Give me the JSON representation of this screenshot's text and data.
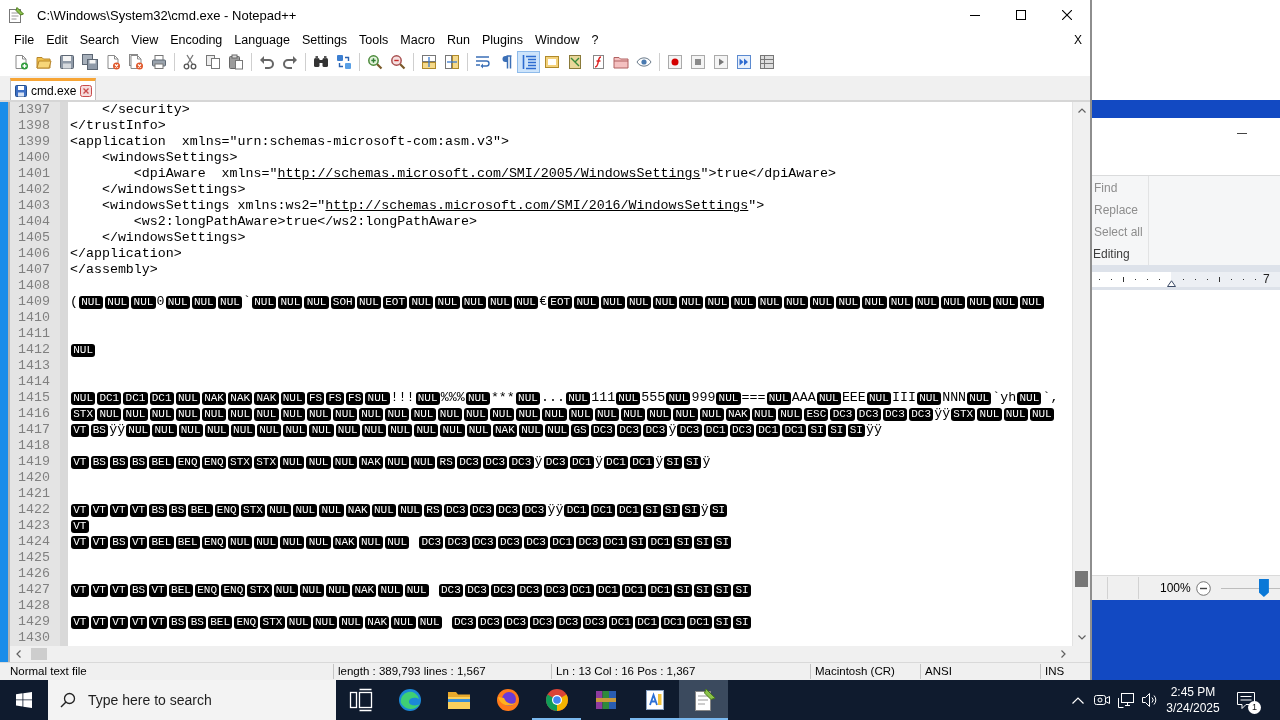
{
  "window": {
    "title": "C:\\Windows\\System32\\cmd.exe - Notepad++"
  },
  "menu": {
    "items": [
      "File",
      "Edit",
      "Search",
      "View",
      "Encoding",
      "Language",
      "Settings",
      "Tools",
      "Macro",
      "Run",
      "Plugins",
      "Window",
      "?"
    ],
    "close": "X"
  },
  "toolbar": [
    {
      "kind": "new",
      "on": false
    },
    {
      "kind": "open",
      "on": false
    },
    {
      "kind": "save",
      "on": false
    },
    {
      "kind": "save-all",
      "on": false
    },
    {
      "kind": "close",
      "on": false
    },
    {
      "kind": "close-all",
      "on": false
    },
    {
      "kind": "print",
      "on": false
    },
    {
      "kind": "separator"
    },
    {
      "kind": "cut",
      "on": false
    },
    {
      "kind": "copy",
      "on": false
    },
    {
      "kind": "paste",
      "on": false
    },
    {
      "kind": "separator"
    },
    {
      "kind": "undo",
      "on": false
    },
    {
      "kind": "redo",
      "on": false
    },
    {
      "kind": "separator"
    },
    {
      "kind": "find",
      "on": false
    },
    {
      "kind": "replace",
      "on": false
    },
    {
      "kind": "separator"
    },
    {
      "kind": "zoom-in",
      "on": false
    },
    {
      "kind": "zoom-out",
      "on": false
    },
    {
      "kind": "separator"
    },
    {
      "kind": "sync-vertical",
      "on": false
    },
    {
      "kind": "sync-horizontal",
      "on": false
    },
    {
      "kind": "separator"
    },
    {
      "kind": "word-wrap",
      "on": false
    },
    {
      "kind": "all-chars",
      "on": false
    },
    {
      "kind": "indent-guide",
      "on": true
    },
    {
      "kind": "user-language",
      "on": false
    },
    {
      "kind": "document-map",
      "on": false
    },
    {
      "kind": "function-list",
      "on": false
    },
    {
      "kind": "folder-workspace",
      "on": false
    },
    {
      "kind": "monitoring",
      "on": false
    },
    {
      "kind": "separator"
    },
    {
      "kind": "record",
      "on": false
    },
    {
      "kind": "stop",
      "on": false
    },
    {
      "kind": "play",
      "on": false
    },
    {
      "kind": "play-multiple",
      "on": false
    },
    {
      "kind": "save-macro",
      "on": false
    }
  ],
  "tabs": [
    {
      "label": "cmd.exe",
      "selected": true
    }
  ],
  "editor": {
    "lines": [
      {
        "number": "1397",
        "tokens": [
          {
            "kind": "text",
            "text": "    </security>"
          }
        ]
      },
      {
        "number": "1398",
        "tokens": [
          {
            "kind": "text",
            "text": "</trustInfo>"
          }
        ]
      },
      {
        "number": "1399",
        "tokens": [
          {
            "kind": "text",
            "text": "<application  xmlns=\"urn:schemas-microsoft-com:asm.v3\">"
          }
        ]
      },
      {
        "number": "1400",
        "tokens": [
          {
            "kind": "text",
            "text": "    <windowsSettings>"
          }
        ]
      },
      {
        "number": "1401",
        "tokens": [
          {
            "kind": "text",
            "text": "        <dpiAware  xmlns=\""
          },
          {
            "kind": "link",
            "text": "http://schemas.microsoft.com/SMI/2005/WindowsSettings"
          },
          {
            "kind": "text",
            "text": "\">true</dpiAware>"
          }
        ]
      },
      {
        "number": "1402",
        "tokens": [
          {
            "kind": "text",
            "text": "    </windowsSettings>"
          }
        ]
      },
      {
        "number": "1403",
        "tokens": [
          {
            "kind": "text",
            "text": "    <windowsSettings xmlns:ws2=\""
          },
          {
            "kind": "link",
            "text": "http://schemas.microsoft.com/SMI/2016/WindowsSettings"
          },
          {
            "kind": "text",
            "text": "\">"
          }
        ]
      },
      {
        "number": "1404",
        "tokens": [
          {
            "kind": "text",
            "text": "        <ws2:longPathAware>true</ws2:longPathAware>"
          }
        ]
      },
      {
        "number": "1405",
        "tokens": [
          {
            "kind": "text",
            "text": "    </windowsSettings>"
          }
        ]
      },
      {
        "number": "1406",
        "tokens": [
          {
            "kind": "text",
            "text": "</application>"
          }
        ]
      },
      {
        "number": "1407",
        "tokens": [
          {
            "kind": "text",
            "text": "</assembly>"
          }
        ]
      },
      {
        "number": "1408"
      },
      {
        "number": "1409",
        "tokens": [
          {
            "kind": "text",
            "text": "("
          },
          {
            "kind": "ctrl",
            "text": "NUL"
          },
          {
            "kind": "ctrl",
            "text": "NUL"
          },
          {
            "kind": "ctrl",
            "text": "NUL"
          },
          {
            "kind": "text",
            "text": "0"
          },
          {
            "kind": "ctrl",
            "text": "NUL"
          },
          {
            "kind": "ctrl",
            "text": "NUL"
          },
          {
            "kind": "ctrl",
            "text": "NUL"
          },
          {
            "kind": "text",
            "text": "`"
          },
          {
            "kind": "ctrl",
            "text": "NUL"
          },
          {
            "kind": "ctrl",
            "text": "NUL"
          },
          {
            "kind": "ctrl",
            "text": "NUL"
          },
          {
            "kind": "ctrl",
            "text": "SOH"
          },
          {
            "kind": "ctrl",
            "text": "NUL"
          },
          {
            "kind": "ctrl",
            "text": "EOT"
          },
          {
            "kind": "ctrl",
            "text": "NUL"
          },
          {
            "kind": "ctrl",
            "text": "NUL"
          },
          {
            "kind": "ctrl",
            "text": "NUL"
          },
          {
            "kind": "ctrl",
            "text": "NUL"
          },
          {
            "kind": "ctrl",
            "text": "NUL"
          },
          {
            "kind": "text",
            "text": "€"
          },
          {
            "kind": "ctrl",
            "text": "EOT"
          },
          {
            "kind": "ctrl",
            "text": "NUL"
          },
          {
            "kind": "ctrl",
            "text": "NUL"
          },
          {
            "kind": "ctrl",
            "text": "NUL"
          },
          {
            "kind": "ctrl",
            "text": "NUL"
          },
          {
            "kind": "ctrl",
            "text": "NUL"
          },
          {
            "kind": "ctrl",
            "text": "NUL"
          },
          {
            "kind": "ctrl",
            "text": "NUL"
          },
          {
            "kind": "ctrl",
            "text": "NUL"
          },
          {
            "kind": "ctrl",
            "text": "NUL"
          },
          {
            "kind": "ctrl",
            "text": "NUL"
          },
          {
            "kind": "ctrl",
            "text": "NUL"
          },
          {
            "kind": "ctrl",
            "text": "NUL"
          },
          {
            "kind": "ctrl",
            "text": "NUL"
          },
          {
            "kind": "ctrl",
            "text": "NUL"
          },
          {
            "kind": "ctrl",
            "text": "NUL"
          },
          {
            "kind": "ctrl",
            "text": "NUL"
          },
          {
            "kind": "ctrl",
            "text": "NUL"
          },
          {
            "kind": "ctrl",
            "text": "NUL"
          }
        ]
      },
      {
        "number": "1410"
      },
      {
        "number": "1411"
      },
      {
        "number": "1412",
        "tokens": [
          {
            "kind": "ctrl",
            "text": "NUL"
          }
        ]
      },
      {
        "number": "1413"
      },
      {
        "number": "1414"
      },
      {
        "number": "1415",
        "tokens": [
          {
            "kind": "ctrl",
            "text": "NUL"
          },
          {
            "kind": "ctrl",
            "text": "DC1"
          },
          {
            "kind": "ctrl",
            "text": "DC1"
          },
          {
            "kind": "ctrl",
            "text": "DC1"
          },
          {
            "kind": "ctrl",
            "text": "NUL"
          },
          {
            "kind": "ctrl",
            "text": "NAK"
          },
          {
            "kind": "ctrl",
            "text": "NAK"
          },
          {
            "kind": "ctrl",
            "text": "NAK"
          },
          {
            "kind": "ctrl",
            "text": "NUL"
          },
          {
            "kind": "ctrl",
            "text": "FS"
          },
          {
            "kind": "ctrl",
            "text": "FS"
          },
          {
            "kind": "ctrl",
            "text": "FS"
          },
          {
            "kind": "ctrl",
            "text": "NUL"
          },
          {
            "kind": "text",
            "text": "!!!"
          },
          {
            "kind": "ctrl",
            "text": "NUL"
          },
          {
            "kind": "text",
            "text": "%%%"
          },
          {
            "kind": "ctrl",
            "text": "NUL"
          },
          {
            "kind": "text",
            "text": "***"
          },
          {
            "kind": "ctrl",
            "text": "NUL"
          },
          {
            "kind": "text",
            "text": "..."
          },
          {
            "kind": "ctrl",
            "text": "NUL"
          },
          {
            "kind": "text",
            "text": "111"
          },
          {
            "kind": "ctrl",
            "text": "NUL"
          },
          {
            "kind": "text",
            "text": "555"
          },
          {
            "kind": "ctrl",
            "text": "NUL"
          },
          {
            "kind": "text",
            "text": "999"
          },
          {
            "kind": "ctrl",
            "text": "NUL"
          },
          {
            "kind": "text",
            "text": "==="
          },
          {
            "kind": "ctrl",
            "text": "NUL"
          },
          {
            "kind": "text",
            "text": "AAA"
          },
          {
            "kind": "ctrl",
            "text": "NUL"
          },
          {
            "kind": "text",
            "text": "EEE"
          },
          {
            "kind": "ctrl",
            "text": "NUL"
          },
          {
            "kind": "text",
            "text": "III"
          },
          {
            "kind": "ctrl",
            "text": "NUL"
          },
          {
            "kind": "text",
            "text": "NNN"
          },
          {
            "kind": "ctrl",
            "text": "NUL"
          },
          {
            "kind": "text",
            "text": "`yh"
          },
          {
            "kind": "ctrl",
            "text": "NUL"
          },
          {
            "kind": "text",
            "text": "`,"
          }
        ]
      },
      {
        "number": "1416",
        "tokens": [
          {
            "kind": "ctrl",
            "text": "STX"
          },
          {
            "kind": "ctrl",
            "text": "NUL"
          },
          {
            "kind": "ctrl",
            "text": "NUL"
          },
          {
            "kind": "ctrl",
            "text": "NUL"
          },
          {
            "kind": "ctrl",
            "text": "NUL"
          },
          {
            "kind": "ctrl",
            "text": "NUL"
          },
          {
            "kind": "ctrl",
            "text": "NUL"
          },
          {
            "kind": "ctrl",
            "text": "NUL"
          },
          {
            "kind": "ctrl",
            "text": "NUL"
          },
          {
            "kind": "ctrl",
            "text": "NUL"
          },
          {
            "kind": "ctrl",
            "text": "NUL"
          },
          {
            "kind": "ctrl",
            "text": "NUL"
          },
          {
            "kind": "ctrl",
            "text": "NUL"
          },
          {
            "kind": "ctrl",
            "text": "NUL"
          },
          {
            "kind": "ctrl",
            "text": "NUL"
          },
          {
            "kind": "ctrl",
            "text": "NUL"
          },
          {
            "kind": "ctrl",
            "text": "NUL"
          },
          {
            "kind": "ctrl",
            "text": "NUL"
          },
          {
            "kind": "ctrl",
            "text": "NUL"
          },
          {
            "kind": "ctrl",
            "text": "NUL"
          },
          {
            "kind": "ctrl",
            "text": "NUL"
          },
          {
            "kind": "ctrl",
            "text": "NUL"
          },
          {
            "kind": "ctrl",
            "text": "NUL"
          },
          {
            "kind": "ctrl",
            "text": "NUL"
          },
          {
            "kind": "ctrl",
            "text": "NUL"
          },
          {
            "kind": "ctrl",
            "text": "NAK"
          },
          {
            "kind": "ctrl",
            "text": "NUL"
          },
          {
            "kind": "ctrl",
            "text": "NUL"
          },
          {
            "kind": "ctrl",
            "text": "ESC"
          },
          {
            "kind": "ctrl",
            "text": "DC3"
          },
          {
            "kind": "ctrl",
            "text": "DC3"
          },
          {
            "kind": "ctrl",
            "text": "DC3"
          },
          {
            "kind": "ctrl",
            "text": "DC3"
          },
          {
            "kind": "text",
            "text": "ÿÿ"
          },
          {
            "kind": "ctrl",
            "text": "STX"
          },
          {
            "kind": "ctrl",
            "text": "NUL"
          },
          {
            "kind": "ctrl",
            "text": "NUL"
          },
          {
            "kind": "ctrl",
            "text": "NUL"
          }
        ]
      },
      {
        "number": "1417",
        "tokens": [
          {
            "kind": "ctrl",
            "text": "VT"
          },
          {
            "kind": "ctrl",
            "text": "BS"
          },
          {
            "kind": "text",
            "text": "ÿÿ"
          },
          {
            "kind": "ctrl",
            "text": "NUL"
          },
          {
            "kind": "ctrl",
            "text": "NUL"
          },
          {
            "kind": "ctrl",
            "text": "NUL"
          },
          {
            "kind": "ctrl",
            "text": "NUL"
          },
          {
            "kind": "ctrl",
            "text": "NUL"
          },
          {
            "kind": "ctrl",
            "text": "NUL"
          },
          {
            "kind": "ctrl",
            "text": "NUL"
          },
          {
            "kind": "ctrl",
            "text": "NUL"
          },
          {
            "kind": "ctrl",
            "text": "NUL"
          },
          {
            "kind": "ctrl",
            "text": "NUL"
          },
          {
            "kind": "ctrl",
            "text": "NUL"
          },
          {
            "kind": "ctrl",
            "text": "NUL"
          },
          {
            "kind": "ctrl",
            "text": "NUL"
          },
          {
            "kind": "ctrl",
            "text": "NUL"
          },
          {
            "kind": "ctrl",
            "text": "NAK"
          },
          {
            "kind": "ctrl",
            "text": "NUL"
          },
          {
            "kind": "ctrl",
            "text": "NUL"
          },
          {
            "kind": "ctrl",
            "text": "GS"
          },
          {
            "kind": "ctrl",
            "text": "DC3"
          },
          {
            "kind": "ctrl",
            "text": "DC3"
          },
          {
            "kind": "ctrl",
            "text": "DC3"
          },
          {
            "kind": "text",
            "text": "ÿ"
          },
          {
            "kind": "ctrl",
            "text": "DC3"
          },
          {
            "kind": "ctrl",
            "text": "DC1"
          },
          {
            "kind": "ctrl",
            "text": "DC3"
          },
          {
            "kind": "ctrl",
            "text": "DC1"
          },
          {
            "kind": "ctrl",
            "text": "DC1"
          },
          {
            "kind": "ctrl",
            "text": "SI"
          },
          {
            "kind": "ctrl",
            "text": "SI"
          },
          {
            "kind": "ctrl",
            "text": "SI"
          },
          {
            "kind": "text",
            "text": "ÿÿ"
          }
        ]
      },
      {
        "number": "1418"
      },
      {
        "number": "1419",
        "tokens": [
          {
            "kind": "ctrl",
            "text": "VT"
          },
          {
            "kind": "ctrl",
            "text": "BS"
          },
          {
            "kind": "ctrl",
            "text": "BS"
          },
          {
            "kind": "ctrl",
            "text": "BS"
          },
          {
            "kind": "ctrl",
            "text": "BEL"
          },
          {
            "kind": "ctrl",
            "text": "ENQ"
          },
          {
            "kind": "ctrl",
            "text": "ENQ"
          },
          {
            "kind": "ctrl",
            "text": "STX"
          },
          {
            "kind": "ctrl",
            "text": "STX"
          },
          {
            "kind": "ctrl",
            "text": "NUL"
          },
          {
            "kind": "ctrl",
            "text": "NUL"
          },
          {
            "kind": "ctrl",
            "text": "NUL"
          },
          {
            "kind": "ctrl",
            "text": "NAK"
          },
          {
            "kind": "ctrl",
            "text": "NUL"
          },
          {
            "kind": "ctrl",
            "text": "NUL"
          },
          {
            "kind": "ctrl",
            "text": "RS"
          },
          {
            "kind": "ctrl",
            "text": "DC3"
          },
          {
            "kind": "ctrl",
            "text": "DC3"
          },
          {
            "kind": "ctrl",
            "text": "DC3"
          },
          {
            "kind": "text",
            "text": "ÿ"
          },
          {
            "kind": "ctrl",
            "text": "DC3"
          },
          {
            "kind": "ctrl",
            "text": "DC1"
          },
          {
            "kind": "text",
            "text": "ÿ"
          },
          {
            "kind": "ctrl",
            "text": "DC1"
          },
          {
            "kind": "ctrl",
            "text": "DC1"
          },
          {
            "kind": "text",
            "text": "ÿ"
          },
          {
            "kind": "ctrl",
            "text": "SI"
          },
          {
            "kind": "ctrl",
            "text": "SI"
          },
          {
            "kind": "text",
            "text": "ÿ"
          }
        ]
      },
      {
        "number": "1420"
      },
      {
        "number": "1421"
      },
      {
        "number": "1422",
        "tokens": [
          {
            "kind": "ctrl",
            "text": "VT"
          },
          {
            "kind": "ctrl",
            "text": "VT"
          },
          {
            "kind": "ctrl",
            "text": "VT"
          },
          {
            "kind": "ctrl",
            "text": "VT"
          },
          {
            "kind": "ctrl",
            "text": "BS"
          },
          {
            "kind": "ctrl",
            "text": "BS"
          },
          {
            "kind": "ctrl",
            "text": "BEL"
          },
          {
            "kind": "ctrl",
            "text": "ENQ"
          },
          {
            "kind": "ctrl",
            "text": "STX"
          },
          {
            "kind": "ctrl",
            "text": "NUL"
          },
          {
            "kind": "ctrl",
            "text": "NUL"
          },
          {
            "kind": "ctrl",
            "text": "NUL"
          },
          {
            "kind": "ctrl",
            "text": "NAK"
          },
          {
            "kind": "ctrl",
            "text": "NUL"
          },
          {
            "kind": "ctrl",
            "text": "NUL"
          },
          {
            "kind": "ctrl",
            "text": "RS"
          },
          {
            "kind": "ctrl",
            "text": "DC3"
          },
          {
            "kind": "ctrl",
            "text": "DC3"
          },
          {
            "kind": "ctrl",
            "text": "DC3"
          },
          {
            "kind": "ctrl",
            "text": "DC3"
          },
          {
            "kind": "text",
            "text": "ÿÿ"
          },
          {
            "kind": "ctrl",
            "text": "DC1"
          },
          {
            "kind": "ctrl",
            "text": "DC1"
          },
          {
            "kind": "ctrl",
            "text": "DC1"
          },
          {
            "kind": "ctrl",
            "text": "SI"
          },
          {
            "kind": "ctrl",
            "text": "SI"
          },
          {
            "kind": "ctrl",
            "text": "SI"
          },
          {
            "kind": "text",
            "text": "ÿ"
          },
          {
            "kind": "ctrl",
            "text": "SI"
          }
        ]
      },
      {
        "number": "1423",
        "tokens": [
          {
            "kind": "ctrl",
            "text": "VT"
          }
        ]
      },
      {
        "number": "1424",
        "tokens": [
          {
            "kind": "ctrl",
            "text": "VT"
          },
          {
            "kind": "ctrl",
            "text": "VT"
          },
          {
            "kind": "ctrl",
            "text": "BS"
          },
          {
            "kind": "ctrl",
            "text": "VT"
          },
          {
            "kind": "ctrl",
            "text": "BEL"
          },
          {
            "kind": "ctrl",
            "text": "BEL"
          },
          {
            "kind": "ctrl",
            "text": "ENQ"
          },
          {
            "kind": "ctrl",
            "text": "NUL"
          },
          {
            "kind": "ctrl",
            "text": "NUL"
          },
          {
            "kind": "ctrl",
            "text": "NUL"
          },
          {
            "kind": "ctrl",
            "text": "NUL"
          },
          {
            "kind": "ctrl",
            "text": "NAK"
          },
          {
            "kind": "ctrl",
            "text": "NUL"
          },
          {
            "kind": "ctrl",
            "text": "NUL"
          },
          {
            "kind": "blank"
          },
          {
            "kind": "ctrl",
            "text": "DC3"
          },
          {
            "kind": "ctrl",
            "text": "DC3"
          },
          {
            "kind": "ctrl",
            "text": "DC3"
          },
          {
            "kind": "ctrl",
            "text": "DC3"
          },
          {
            "kind": "ctrl",
            "text": "DC3"
          },
          {
            "kind": "ctrl",
            "text": "DC1"
          },
          {
            "kind": "ctrl",
            "text": "DC3"
          },
          {
            "kind": "ctrl",
            "text": "DC1"
          },
          {
            "kind": "ctrl",
            "text": "SI"
          },
          {
            "kind": "ctrl",
            "text": "DC1"
          },
          {
            "kind": "ctrl",
            "text": "SI"
          },
          {
            "kind": "ctrl",
            "text": "SI"
          },
          {
            "kind": "ctrl",
            "text": "SI"
          }
        ]
      },
      {
        "number": "1425"
      },
      {
        "number": "1426"
      },
      {
        "number": "1427",
        "tokens": [
          {
            "kind": "ctrl",
            "text": "VT"
          },
          {
            "kind": "ctrl",
            "text": "VT"
          },
          {
            "kind": "ctrl",
            "text": "VT"
          },
          {
            "kind": "ctrl",
            "text": "BS"
          },
          {
            "kind": "ctrl",
            "text": "VT"
          },
          {
            "kind": "ctrl",
            "text": "BEL"
          },
          {
            "kind": "ctrl",
            "text": "ENQ"
          },
          {
            "kind": "ctrl",
            "text": "ENQ"
          },
          {
            "kind": "ctrl",
            "text": "STX"
          },
          {
            "kind": "ctrl",
            "text": "NUL"
          },
          {
            "kind": "ctrl",
            "text": "NUL"
          },
          {
            "kind": "ctrl",
            "text": "NUL"
          },
          {
            "kind": "ctrl",
            "text": "NAK"
          },
          {
            "kind": "ctrl",
            "text": "NUL"
          },
          {
            "kind": "ctrl",
            "text": "NUL"
          },
          {
            "kind": "blank"
          },
          {
            "kind": "ctrl",
            "text": "DC3"
          },
          {
            "kind": "ctrl",
            "text": "DC3"
          },
          {
            "kind": "ctrl",
            "text": "DC3"
          },
          {
            "kind": "ctrl",
            "text": "DC3"
          },
          {
            "kind": "ctrl",
            "text": "DC3"
          },
          {
            "kind": "ctrl",
            "text": "DC1"
          },
          {
            "kind": "ctrl",
            "text": "DC1"
          },
          {
            "kind": "ctrl",
            "text": "DC1"
          },
          {
            "kind": "ctrl",
            "text": "DC1"
          },
          {
            "kind": "ctrl",
            "text": "SI"
          },
          {
            "kind": "ctrl",
            "text": "SI"
          },
          {
            "kind": "ctrl",
            "text": "SI"
          },
          {
            "kind": "ctrl",
            "text": "SI"
          }
        ]
      },
      {
        "number": "1428"
      },
      {
        "number": "1429",
        "tokens": [
          {
            "kind": "ctrl",
            "text": "VT"
          },
          {
            "kind": "ctrl",
            "text": "VT"
          },
          {
            "kind": "ctrl",
            "text": "VT"
          },
          {
            "kind": "ctrl",
            "text": "VT"
          },
          {
            "kind": "ctrl",
            "text": "VT"
          },
          {
            "kind": "ctrl",
            "text": "BS"
          },
          {
            "kind": "ctrl",
            "text": "BS"
          },
          {
            "kind": "ctrl",
            "text": "BEL"
          },
          {
            "kind": "ctrl",
            "text": "ENQ"
          },
          {
            "kind": "ctrl",
            "text": "STX"
          },
          {
            "kind": "ctrl",
            "text": "NUL"
          },
          {
            "kind": "ctrl",
            "text": "NUL"
          },
          {
            "kind": "ctrl",
            "text": "NUL"
          },
          {
            "kind": "ctrl",
            "text": "NAK"
          },
          {
            "kind": "ctrl",
            "text": "NUL"
          },
          {
            "kind": "ctrl",
            "text": "NUL"
          },
          {
            "kind": "blank"
          },
          {
            "kind": "ctrl",
            "text": "DC3"
          },
          {
            "kind": "ctrl",
            "text": "DC3"
          },
          {
            "kind": "ctrl",
            "text": "DC3"
          },
          {
            "kind": "ctrl",
            "text": "DC3"
          },
          {
            "kind": "ctrl",
            "text": "DC3"
          },
          {
            "kind": "ctrl",
            "text": "DC3"
          },
          {
            "kind": "ctrl",
            "text": "DC1"
          },
          {
            "kind": "ctrl",
            "text": "DC1"
          },
          {
            "kind": "ctrl",
            "text": "DC1"
          },
          {
            "kind": "ctrl",
            "text": "DC1"
          },
          {
            "kind": "ctrl",
            "text": "SI"
          },
          {
            "kind": "ctrl",
            "text": "SI"
          }
        ]
      },
      {
        "number": "1430"
      }
    ]
  },
  "status_bar": [
    "Normal text file",
    "length : 389,793    lines : 1,567",
    "Ln : 13    Col : 16    Pos : 1,367",
    "Macintosh (CR)",
    "ANSI",
    "INS"
  ],
  "wordpad": {
    "commands": [
      {
        "label": "Find",
        "disabled": true
      },
      {
        "label": "Replace",
        "disabled": true
      },
      {
        "label": "Select all",
        "disabled": true
      }
    ],
    "group_label": "Editing",
    "ruler_number": "7",
    "zoom": "100%",
    "zoom_slider": {
      "level": 0.72
    }
  },
  "taskbar": {
    "search": {
      "placeholder": "Type here to search"
    },
    "apps": [
      {
        "kind": "task-view",
        "running": false,
        "active": false
      },
      {
        "kind": "swirl-browser",
        "running": false,
        "active": false
      },
      {
        "kind": "folder",
        "running": false,
        "active": false
      },
      {
        "kind": "fox-browser",
        "running": false,
        "active": false
      },
      {
        "kind": "round-browser",
        "running": true,
        "active": false
      },
      {
        "kind": "archive",
        "running": false,
        "active": false
      },
      {
        "kind": "wordpad",
        "running": true,
        "active": false
      },
      {
        "kind": "notepad",
        "running": true,
        "active": true
      }
    ],
    "time": "2:45 PM",
    "date": "3/24/2025",
    "notification_count": "1"
  }
}
